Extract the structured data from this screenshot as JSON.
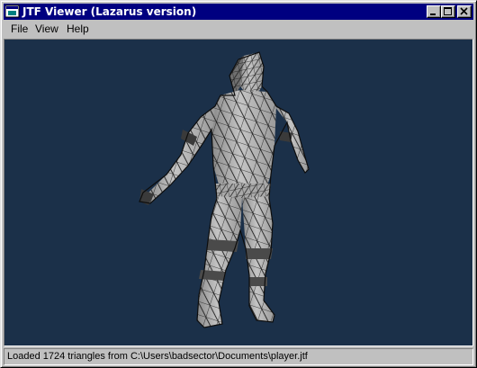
{
  "window": {
    "title": "JTF Viewer (Lazarus version)",
    "controls": [
      "minimize-icon",
      "maximize-icon",
      "close-icon"
    ]
  },
  "menu": {
    "items": [
      {
        "label": "File"
      },
      {
        "label": "View"
      },
      {
        "label": "Help"
      }
    ]
  },
  "viewport": {
    "background_color": "#1b3049",
    "model_fill_color": "#bdbdbd",
    "wireframe_color": "#111111",
    "content": "3d-wireframe-model"
  },
  "status": {
    "text": "Loaded 1724 triangles from C:\\Users\\badsector\\Documents\\player.jtf"
  },
  "theme": {
    "titlebar_color": "#000080",
    "face_color": "#c0c0c0"
  }
}
